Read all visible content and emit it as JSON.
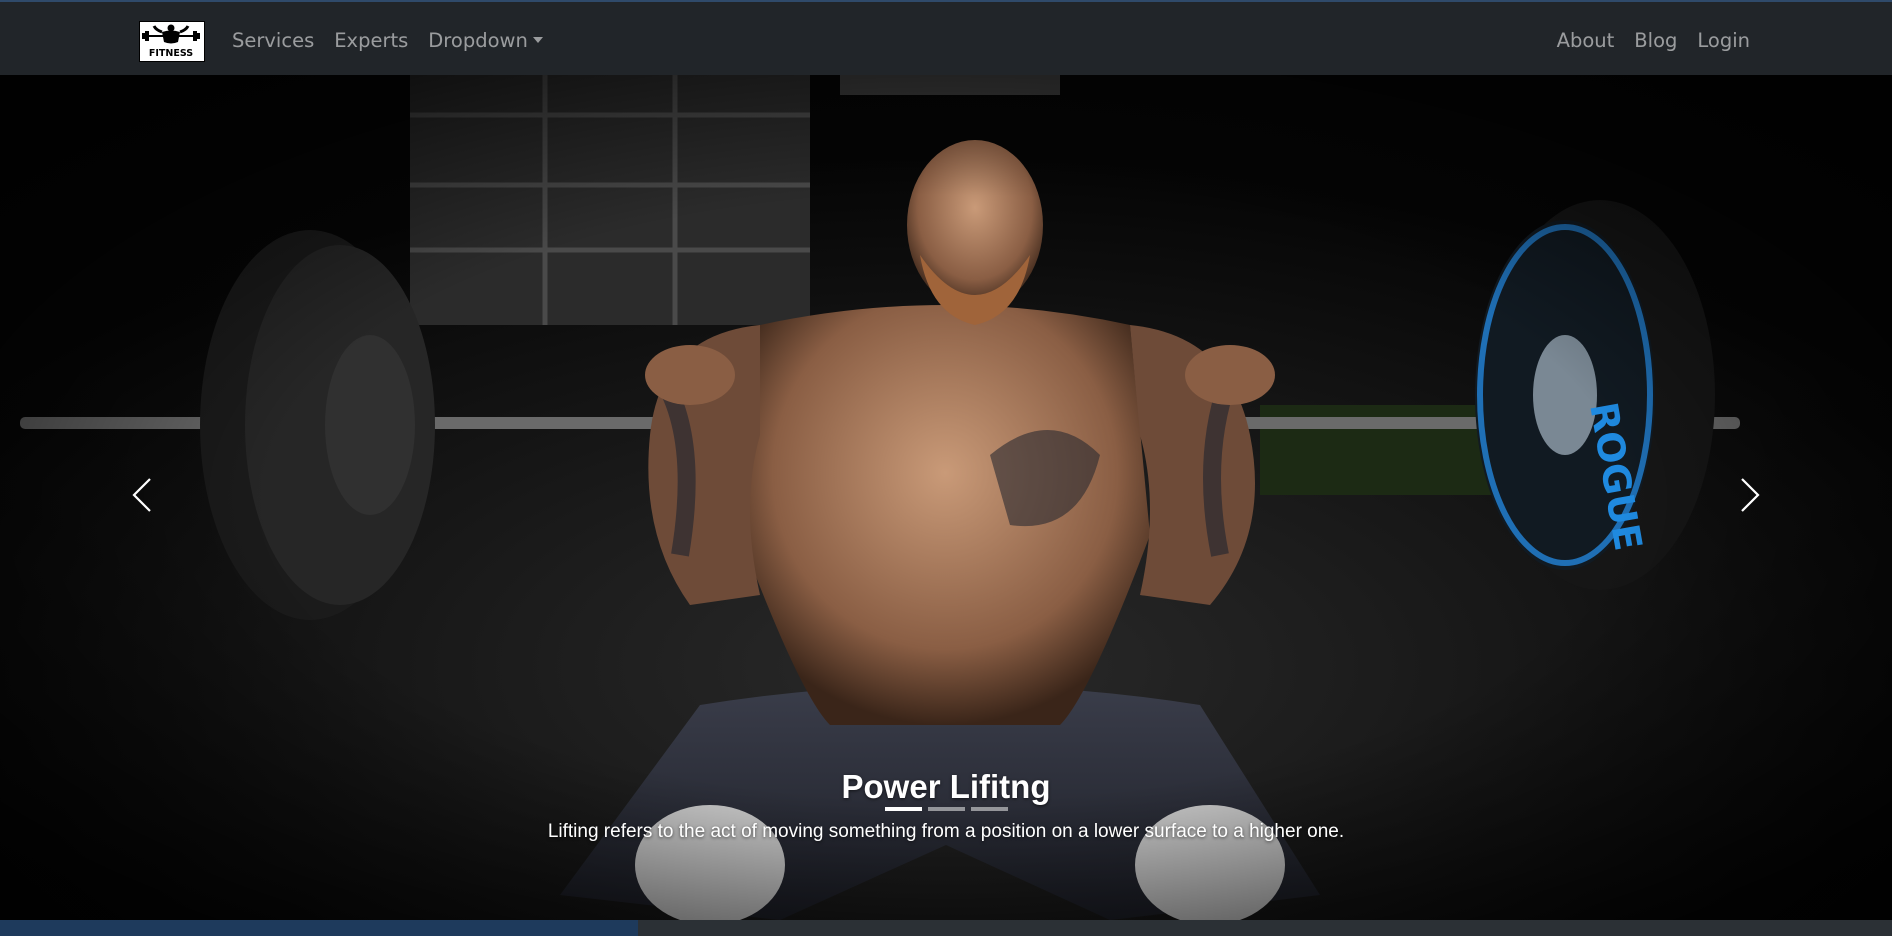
{
  "navbar": {
    "brand": {
      "logo_icon": "dumbbell-bodybuilder-logo",
      "text": "FITNESS"
    },
    "left_links": [
      {
        "label": "Services"
      },
      {
        "label": "Experts"
      },
      {
        "label": "Dropdown"
      }
    ],
    "right_links": [
      {
        "label": "About"
      },
      {
        "label": "Blog"
      },
      {
        "label": "Login"
      }
    ]
  },
  "carousel": {
    "slide": {
      "image": "weightlifter-front-squat-photo",
      "title": "Power Lifitng",
      "text": "Lifting refers to the act of moving something from a position on a lower surface to a higher one."
    },
    "indicators_count": 3,
    "active_index": 0,
    "prev_icon": "chevron-left-icon",
    "next_icon": "chevron-right-icon"
  },
  "footer_strip": {
    "progress": 0.337
  },
  "colors": {
    "navbar_bg": "#212529",
    "nav_link": "rgba(255,255,255,0.55)",
    "strip_fill": "#1e3a5c"
  }
}
